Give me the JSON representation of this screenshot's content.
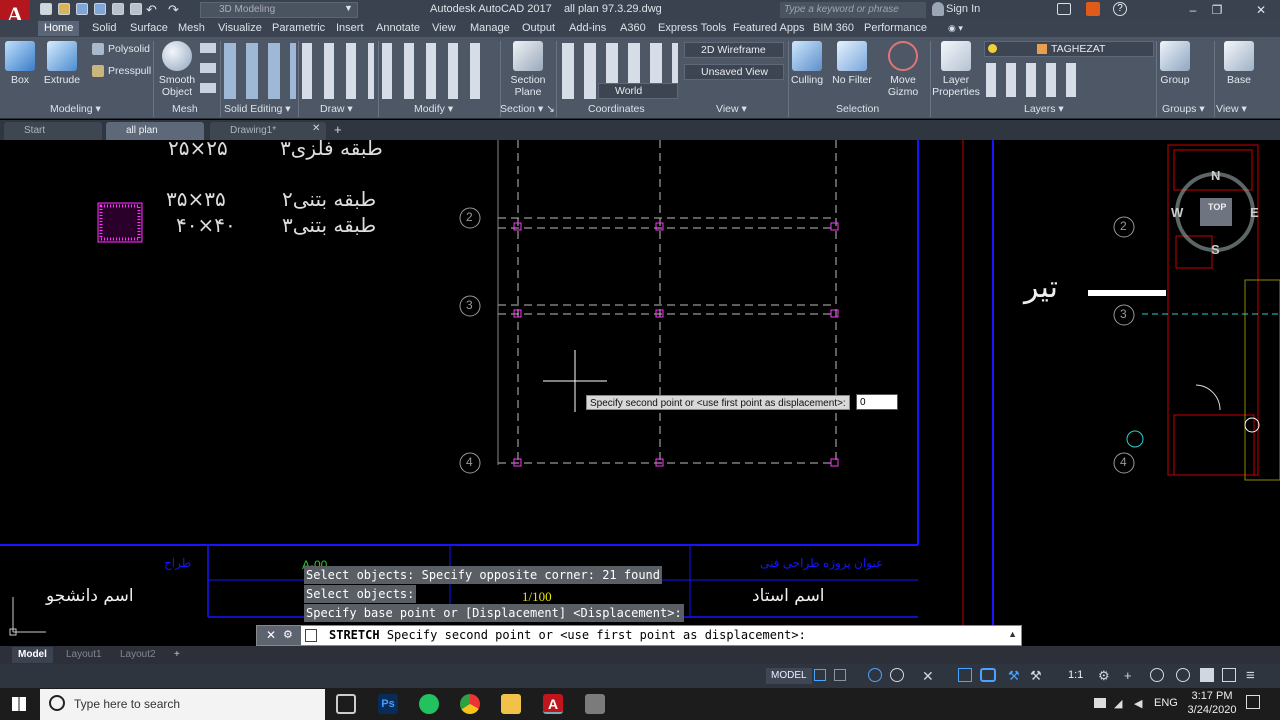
{
  "title": {
    "app_logo": "A",
    "workspace": "3D Modeling",
    "app_name": "Autodesk AutoCAD 2017",
    "document": "all plan 97.3.29.dwg",
    "search_placeholder": "Type a keyword or phrase",
    "sign_in": "Sign In",
    "help": "?"
  },
  "ribbon_tabs": [
    "Home",
    "Solid",
    "Surface",
    "Mesh",
    "Visualize",
    "Parametric",
    "Insert",
    "Annotate",
    "View",
    "Manage",
    "Output",
    "Add-ins",
    "A360",
    "Express Tools",
    "Featured Apps",
    "BIM 360",
    "Performance"
  ],
  "ribbon": {
    "box": "Box",
    "extrude": "Extrude",
    "polysolid": "Polysolid",
    "presspull": "Presspull",
    "smooth_object": "Smooth Object",
    "section_plane": "Section Plane",
    "visual_style": "2D Wireframe",
    "view_combo": "Unsaved View",
    "ucs": "World",
    "culling": "Culling",
    "no_filter": "No Filter",
    "move_gizmo": "Move Gizmo",
    "layer_properties": "Layer Properties",
    "layer_name": "TAGHEZAT",
    "group": "Group",
    "base": "Base",
    "panels": [
      "Modeling",
      "Mesh",
      "Solid Editing",
      "Draw",
      "Modify",
      "Section",
      "Coordinates",
      "View",
      "Selection",
      "Layers",
      "Groups",
      "View"
    ]
  },
  "file_tabs": [
    "Start",
    "all plan 97.3.29*",
    "Drawing1*"
  ],
  "drawing": {
    "labels_top": [
      "۳طبقه فلزی",
      "۲۵×۲۵"
    ],
    "row2_text": "۲طبقه بتنی",
    "row2_dim": "۳۵×۳۵",
    "row3_text": "۳طبقه بتنی",
    "row3_dim": "۴۰×۴۰",
    "grid_2": "2",
    "grid_3": "3",
    "grid_4": "4",
    "right_grid_2": "2",
    "right_grid_3": "3",
    "right_grid_4": "4",
    "tir_label": "تیر",
    "student_name": "اسم دانشجو",
    "teacher_name": "اسم استاد",
    "scale": "1/100",
    "sheet": "A-00",
    "tb_design": "طراح",
    "tb_project": "عنوان پروژه طراحی فنی",
    "compass": {
      "top": "TOP",
      "n": "N",
      "s": "S",
      "w": "W",
      "e": "E"
    }
  },
  "tooltip": {
    "prompt": "Specify second point or <use first point as displacement>:",
    "value": "0"
  },
  "command_history": [
    "Select objects: Specify opposite corner: 21 found",
    "Select objects:",
    "Specify base point or [Displacement] <Displacement>:"
  ],
  "command_line": {
    "cmd": "STRETCH",
    "prompt": "Specify second point or <use first point as displacement>:"
  },
  "layout_tabs": [
    "Model",
    "Layout1",
    "Layout2"
  ],
  "status": {
    "model": "MODEL",
    "scale": "1:1"
  },
  "taskbar": {
    "search": "Type here to search",
    "lang": "ENG",
    "time": "3:17 PM",
    "date": "3/24/2020"
  },
  "colors": {
    "ribbon": "#4d5766",
    "titlebar": "#39424e",
    "frame_blue": "#1515ff",
    "magenta": "#ff35ff"
  }
}
